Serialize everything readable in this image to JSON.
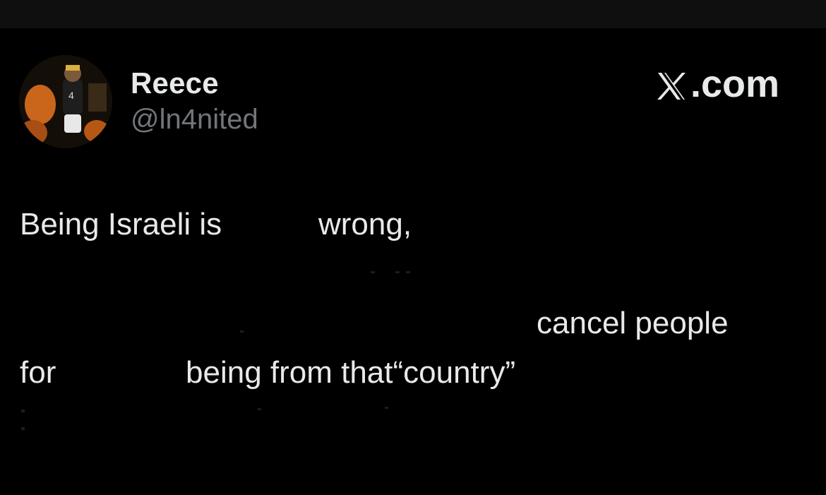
{
  "author": {
    "display_name": "Reece",
    "handle": "@ln4nited",
    "avatar_icon": "profile-photo"
  },
  "brand": {
    "label": ".com",
    "icon": "x-logo-icon"
  },
  "tweet": {
    "fragments": [
      "Being Israeli is",
      "wrong,",
      "cancel people",
      "for",
      "being from that“country”"
    ]
  },
  "colors": {
    "background": "#000000",
    "top_bar": "#0f0f0f",
    "primary_text": "#e7e9ea",
    "secondary_text": "#71767b"
  }
}
